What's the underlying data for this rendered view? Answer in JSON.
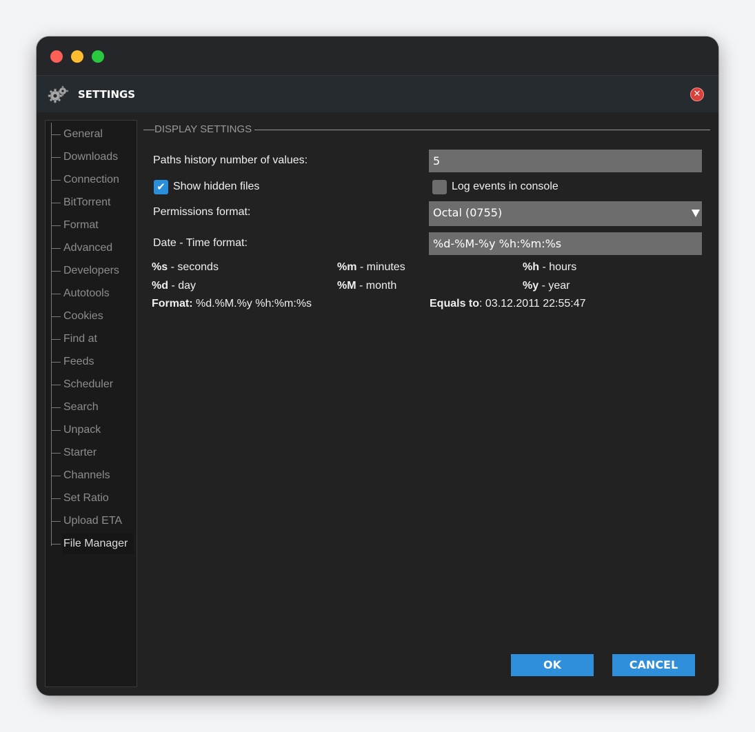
{
  "dialog": {
    "title": "SETTINGS",
    "close_symbol": "✕"
  },
  "sidebar": {
    "items": [
      {
        "label": "General"
      },
      {
        "label": "Downloads"
      },
      {
        "label": "Connection"
      },
      {
        "label": "BitTorrent"
      },
      {
        "label": "Format"
      },
      {
        "label": "Advanced"
      },
      {
        "label": "Developers"
      },
      {
        "label": "Autotools"
      },
      {
        "label": "Cookies"
      },
      {
        "label": "Find at"
      },
      {
        "label": "Feeds"
      },
      {
        "label": "Scheduler"
      },
      {
        "label": "Search"
      },
      {
        "label": "Unpack"
      },
      {
        "label": "Starter"
      },
      {
        "label": "Channels"
      },
      {
        "label": "Set Ratio"
      },
      {
        "label": "Upload ETA"
      },
      {
        "label": "File Manager"
      }
    ],
    "active": "File Manager"
  },
  "display": {
    "section_title": "DISPLAY SETTINGS",
    "paths_history_label": "Paths history number of values:",
    "paths_history_value": "5",
    "show_hidden_label": "Show hidden files",
    "show_hidden_checked": true,
    "log_events_label": "Log events in console",
    "log_events_checked": false,
    "permissions_label": "Permissions format:",
    "permissions_value": "Octal (0755)",
    "datetime_label": "Date - Time format:",
    "datetime_value": "%d-%M-%y %h:%m:%s"
  },
  "format_help": {
    "s_code": "%s",
    "s_desc": " - seconds",
    "m_code": "%m",
    "m_desc": " - minutes",
    "h_code": "%h",
    "h_desc": " - hours",
    "d_code": "%d",
    "d_desc": " - day",
    "M_code": "%M",
    "M_desc": " - month",
    "y_code": "%y",
    "y_desc": " - year",
    "format_label": "Format:",
    "format_value": " %d.%M.%y %h:%m:%s",
    "equals_label": "Equals to",
    "equals_value": ": 03.12.2011 22:55:47"
  },
  "buttons": {
    "ok": "OK",
    "cancel": "CANCEL"
  },
  "colors": {
    "window_bg": "#222222",
    "header_bg": "#262b30",
    "accent": "#2f8fdb",
    "field_bg": "#6d6d6d",
    "close_red": "#d9413a"
  },
  "icons": {
    "header": "gear-icon",
    "close": "close-icon",
    "dropdown": "caret-down-icon",
    "check": "checkmark-icon"
  }
}
